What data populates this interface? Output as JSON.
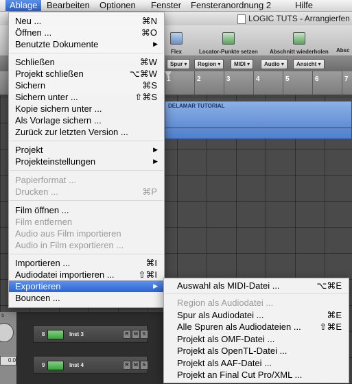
{
  "menubar": {
    "items": [
      "Ablage",
      "Bearbeiten",
      "Optionen",
      "Fenster",
      "Fensteranordnung 2",
      "Hilfe"
    ]
  },
  "window": {
    "title": "LOGIC TUTS - Arrangierfen"
  },
  "toolbar": {
    "flex": "Flex",
    "locator": "Locator-Punkte setzen",
    "repeat": "Abschnitt wiederholen",
    "abs": "Absc"
  },
  "arrange_menus": [
    "Spur",
    "Region",
    "MIDI",
    "Audio",
    "Ansicht"
  ],
  "ruler": [
    "1",
    "2",
    "3",
    "4",
    "5",
    "6",
    "7"
  ],
  "region": {
    "name": "DELAMAR TUTORIAL"
  },
  "tracks": [
    {
      "num": "8",
      "name": "Inst 3"
    },
    {
      "num": "9",
      "name": "Inst 4"
    }
  ],
  "leftstrip": {
    "label": "s",
    "value": "0.0"
  },
  "ablage_menu": {
    "items": [
      {
        "label": "Neu ...",
        "shortcut": "⌘N"
      },
      {
        "label": "Öffnen ...",
        "shortcut": "⌘O"
      },
      {
        "label": "Benutzte Dokumente",
        "submenu": "▶"
      },
      {
        "label": "Schließen",
        "shortcut": "⌘W"
      },
      {
        "label": "Projekt schließen",
        "shortcut": "⌥⌘W"
      },
      {
        "label": "Sichern",
        "shortcut": "⌘S"
      },
      {
        "label": "Sichern unter ...",
        "shortcut": "⇧⌘S"
      },
      {
        "label": "Kopie sichern unter ..."
      },
      {
        "label": "Als Vorlage sichern ..."
      },
      {
        "label": "Zurück zur letzten Version ..."
      },
      {
        "label": "Projekt",
        "submenu": "▶"
      },
      {
        "label": "Projekteinstellungen",
        "submenu": "▶"
      },
      {
        "label": "Papierformat ...",
        "disabled": true
      },
      {
        "label": "Drucken ...",
        "shortcut": "⌘P",
        "disabled": true
      },
      {
        "label": "Film öffnen ..."
      },
      {
        "label": "Film entfernen",
        "disabled": true
      },
      {
        "label": "Audio aus Film importieren",
        "disabled": true
      },
      {
        "label": "Audio in Film exportieren ...",
        "disabled": true
      },
      {
        "label": "Importieren ...",
        "shortcut": "⌘I"
      },
      {
        "label": "Audiodatei importieren ...",
        "shortcut": "⇧⌘I"
      },
      {
        "label": "Exportieren",
        "submenu": "▶",
        "selected": true
      },
      {
        "label": "Bouncen ..."
      }
    ]
  },
  "export_menu": {
    "items": [
      {
        "label": "Auswahl als MIDI-Datei ...",
        "shortcut": "⌥⌘E"
      },
      {
        "label": "Region als Audiodatei ...",
        "disabled": true
      },
      {
        "label": "Spur als Audiodatei ...",
        "shortcut": "⌘E"
      },
      {
        "label": "Alle Spuren als Audiodateien ...",
        "shortcut": "⇧⌘E"
      },
      {
        "label": "Projekt als OMF-Datei ..."
      },
      {
        "label": "Projekt als OpenTL-Datei ..."
      },
      {
        "label": "Projekt als AAF-Datei ..."
      },
      {
        "label": "Projekt an Final Cut Pro/XML ..."
      }
    ]
  },
  "colors": {
    "selection": "#2c63d2",
    "menubar_active": "#3f72d8",
    "region": "#6f98da"
  }
}
